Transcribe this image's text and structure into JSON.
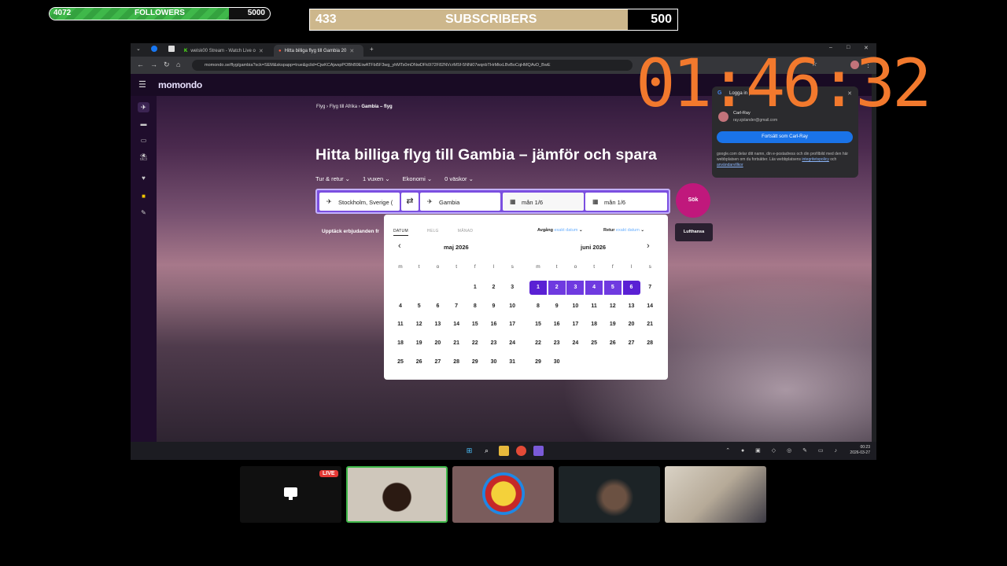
{
  "overlay": {
    "followers": {
      "current": "4072",
      "label": "FOLLOWERS",
      "goal": "5000",
      "progress": 0.814
    },
    "subscribers": {
      "current": "433",
      "label": "SUBSCRIBERS",
      "goal": "500",
      "progress": 0.866
    },
    "timer": "01:46:32"
  },
  "browser": {
    "tabs": [
      {
        "label": "welsk00 Stream - Watch Live o",
        "active": false
      },
      {
        "label": "Hitta billiga flyg till Gambia 20",
        "active": true
      }
    ],
    "url": "momondo.se/flyg/gambia?sck=SEM&skspapp=true&gclid=CjwKCAjwspPOBhB9EiwATFbi5F3wg_yhMTs0mDNwDFk0I72F82NVcrMSf-5NNi07wqnbTHrMkxLBvBoCqHMQAvD_BwE"
  },
  "site": {
    "logo": "momondo",
    "breadcrumbs": [
      "Flyg",
      "Flyg till Afrika",
      "Gambia – flyg"
    ],
    "headline": "Hitta billiga flyg till Gambia – jämför och spara",
    "options": [
      "Tur & retur",
      "1 vuxen",
      "Ekonomi",
      "0 väskor"
    ],
    "from": "Stockholm, Sverige (",
    "to": "Gambia",
    "depart": "mån 1/6",
    "return": "mån 1/6",
    "search_button": "Sök",
    "deals_text": "Upptäck erbjudanden fr",
    "airline_chip": "Lufthansa"
  },
  "calendar": {
    "tabs": [
      "DATUM",
      "HELG",
      "MÅNAD"
    ],
    "departure_label": "Avgång",
    "departure_value": "exakt datum",
    "return_label": "Retur",
    "return_value": "exakt datum",
    "weekdays": [
      "m",
      "t",
      "o",
      "t",
      "f",
      "l",
      "s"
    ],
    "months": [
      {
        "title": "maj 2026",
        "offset": 4,
        "days": 31
      },
      {
        "title": "juni 2026",
        "offset": 0,
        "days": 30
      }
    ],
    "selected_range": [
      1,
      6
    ]
  },
  "google_popup": {
    "title": "Logga in på mom",
    "name": "Carl-Ray",
    "email": "ray.sjolander@gmail.com",
    "button": "Fortsätt som Carl-Ray",
    "info": "google.com delar ditt namn, din e-postadress och din profilbild med den här webbplatsen om du fortsätter. Läs webbplatsens",
    "link1": "integritetspolicy",
    "och": " och ",
    "link2": "användarvillkor"
  },
  "taskbar": {
    "time": "00:23",
    "date": "2026-03-27"
  },
  "stream": {
    "live_badge": "LIVE"
  },
  "colors": {
    "accent": "#6f3ae0",
    "timer": "#f2792d",
    "search": "#c0187c"
  }
}
